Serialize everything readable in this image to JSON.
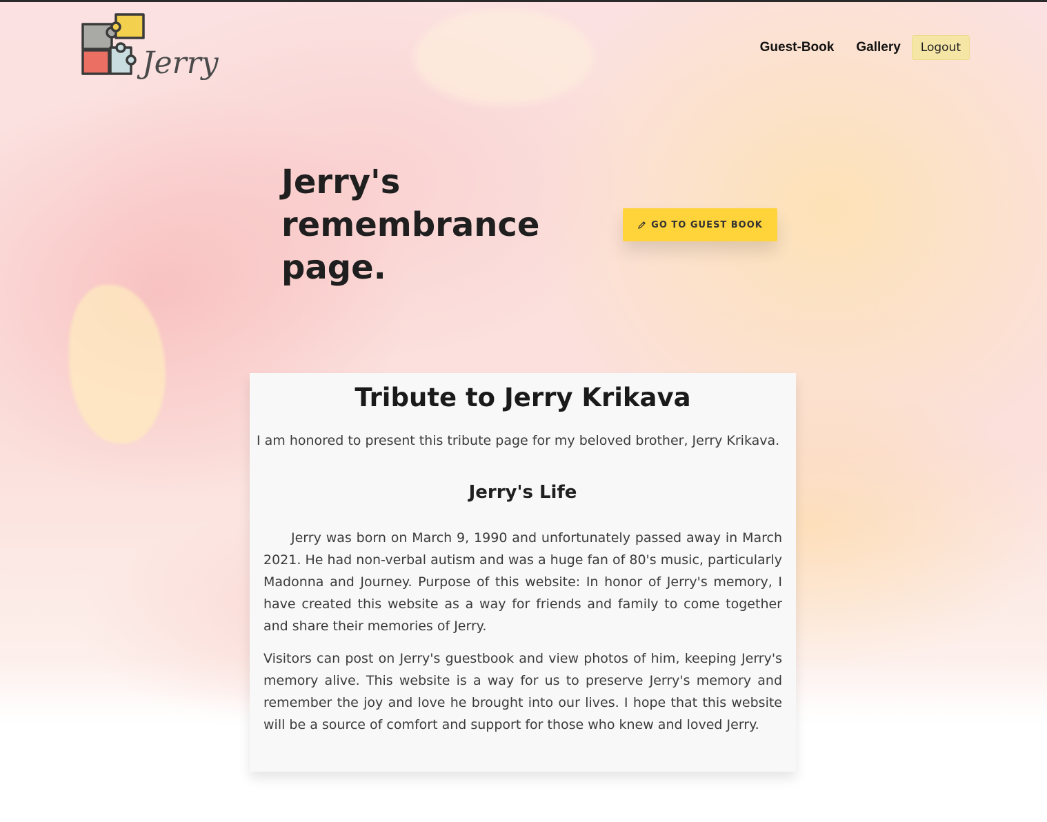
{
  "header": {
    "logo_text": "Jerry",
    "nav": {
      "guestbook_label": "Guest-Book",
      "gallery_label": "Gallery",
      "logout_label": "Logout"
    }
  },
  "hero": {
    "title": "Jerry's remembrance page.",
    "cta_label": "GO TO GUEST BOOK",
    "cta_icon": "pencil-icon"
  },
  "tribute": {
    "title": "Tribute to Jerry Krikava",
    "intro": "I am honored to present this tribute page for my beloved brother, Jerry Krikava.",
    "life_heading": "Jerry's Life",
    "paragraph1": "Jerry was born on March 9, 1990 and unfortunately passed away in March 2021. He had non-verbal autism and was a huge fan of 80's music, particularly Madonna and Journey. Purpose of this website: In honor of Jerry's memory, I have created this website as a way for friends and family to come together and share their memories of Jerry.",
    "paragraph2": "Visitors can post on Jerry's guestbook and view photos of him, keeping Jerry's memory alive. This website is a way for us to preserve Jerry's memory and remember the joy and love he brought into our lives. I hope that this website will be a source of comfort and support for those who knew and loved Jerry."
  },
  "colors": {
    "cta_background": "#ffd33a",
    "logout_background": "#f6e6a6",
    "card_background": "#f8f8f8",
    "puzzle_gray": "#a9aaa5",
    "puzzle_yellow": "#f4d04f",
    "puzzle_red": "#ec6f63",
    "puzzle_light_blue": "#c9dde0"
  }
}
